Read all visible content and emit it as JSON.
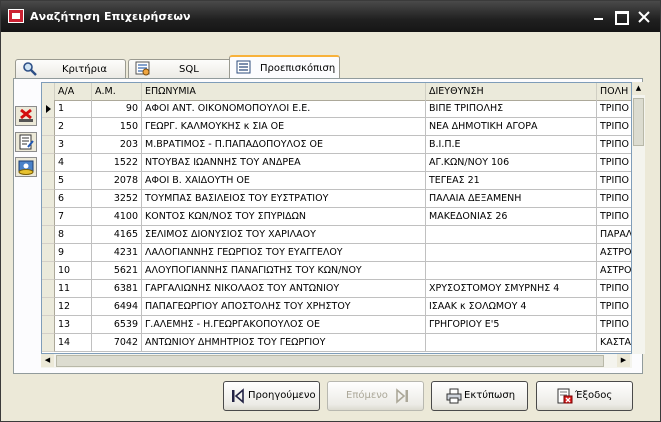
{
  "window": {
    "title": "Αναζήτηση Επιχειρήσεων"
  },
  "tabs": [
    {
      "label": "Κριτήρια",
      "icon": "search-icon"
    },
    {
      "label": "SQL",
      "icon": "sql-icon"
    },
    {
      "label": "Προεπισκόπιση",
      "icon": "preview-icon"
    }
  ],
  "grid": {
    "columns": [
      "Α/Α",
      "Α.Μ.",
      "ΕΠΩΝΥΜΙΑ",
      "ΔΙΕΥΘΥΝΣΗ",
      "ΠΟΛΗ"
    ],
    "rows": [
      [
        "1",
        "90",
        "ΑΦΟΙ ΑΝΤ. ΟΙΚΟΝΟΜΟΠΟΥΛΟΙ Ε.Ε.",
        "ΒΙΠΕ ΤΡΙΠΟΛΗΣ",
        "ΤΡΙΠΟ"
      ],
      [
        "2",
        "150",
        "ΓΕΩΡΓ. ΚΑΛΜΟΥΚΗΣ κ ΣΙΑ ΟΕ",
        "ΝΕΑ ΔΗΜΟΤΙΚΗ ΑΓΟΡΑ",
        "ΤΡΙΠΟ"
      ],
      [
        "3",
        "203",
        "Μ.ΒΡΑΤΙΜΟΣ - Π.ΠΑΠΑΔΟΠΟΥΛΟΣ ΟΕ",
        "Β.Ι.Π.Ε",
        "ΤΡΙΠΟ"
      ],
      [
        "4",
        "1522",
        "ΝΤΟΥΒΑΣ ΙΩΑΝΝΗΣ ΤΟΥ ΑΝΔΡΕΑ",
        "ΑΓ.ΚΩΝ/ΝΟΥ 106",
        "ΤΡΙΠΟ"
      ],
      [
        "5",
        "2078",
        "ΑΦΟΙ Β. ΧΑΙΔΟΥΤΗ  ΟΕ",
        "ΤΕΓΕΑΣ 21",
        "ΤΡΙΠΟ"
      ],
      [
        "6",
        "3252",
        "ΤΟΥΜΠΑΣ ΒΑΣΙΛΕΙΟΣ ΤΟΥ ΕΥΣΤΡΑΤΙΟΥ",
        "ΠΑΛΑΙΑ ΔΕΞΑΜΕΝΗ",
        "ΤΡΙΠΟ"
      ],
      [
        "7",
        "4100",
        "ΚΟΝΤΟΣ ΚΩΝ/ΝΟΣ ΤΟΥ ΣΠΥΡΙΔΩΝ",
        "ΜΑΚΕΔΟΝΙΑΣ 26",
        "ΤΡΙΠΟ"
      ],
      [
        "8",
        "4165",
        "ΣΕΛΙΜΟΣ ΔΙΟΝΥΣΙΟΣ ΤΟΥ ΧΑΡΙΛΑΟΥ",
        "",
        "ΠΑΡΑΛ"
      ],
      [
        "9",
        "4231",
        "ΛΑΛΟΓΙΑΝΝΗΣ ΓΕΩΡΓΙΟΣ ΤΟΥ ΕΥΑΓΓΕΛΟΥ",
        "",
        "ΑΣΤΡΟ"
      ],
      [
        "10",
        "5621",
        "ΑΛΟΥΠΟΓΙΑΝΝΗΣ ΠΑΝΑΓΙΩΤΗΣ ΤΟΥ ΚΩΝ/ΝΟΥ",
        "",
        "ΑΣΤΡΟ"
      ],
      [
        "11",
        "6381",
        "ΓΑΡΓΑΛΙΩΝΗΣ ΝΙΚΟΛΑΟΣ ΤΟΥ ΑΝΤΩΝΙΟΥ",
        "ΧΡΥΣΟΣΤΟΜΟΥ ΣΜΥΡΝΗΣ 4",
        "ΤΡΙΠΟ"
      ],
      [
        "12",
        "6494",
        "ΠΑΠΑΓΕΩΡΓΙΟΥ ΑΠΟΣΤΟΛΗΣ ΤΟΥ ΧΡΗΣΤΟΥ",
        "ΙΣΑΑΚ κ ΣΟΛΩΜΟΥ 4",
        "ΤΡΙΠΟ"
      ],
      [
        "13",
        "6539",
        "Γ.ΑΛΕΜΗΣ - Η.ΓΕΩΡΓΑΚΟΠΟΥΛΟΣ ΟΕ",
        "ΓΡΗΓΟΡΙΟΥ Ε'5",
        "ΤΡΙΠΟ"
      ],
      [
        "14",
        "7042",
        "ΑΝΤΩΝΙΟΥ ΔΗΜΗΤΡΙΟΣ ΤΟΥ ΓΕΩΡΓΙΟΥ",
        "",
        "ΚΑΣΤΑ"
      ]
    ]
  },
  "buttons": {
    "prev": "Προηγούμενο",
    "next": "Επόμενο",
    "print": "Εκτύπωση",
    "exit": "Έξοδος"
  }
}
